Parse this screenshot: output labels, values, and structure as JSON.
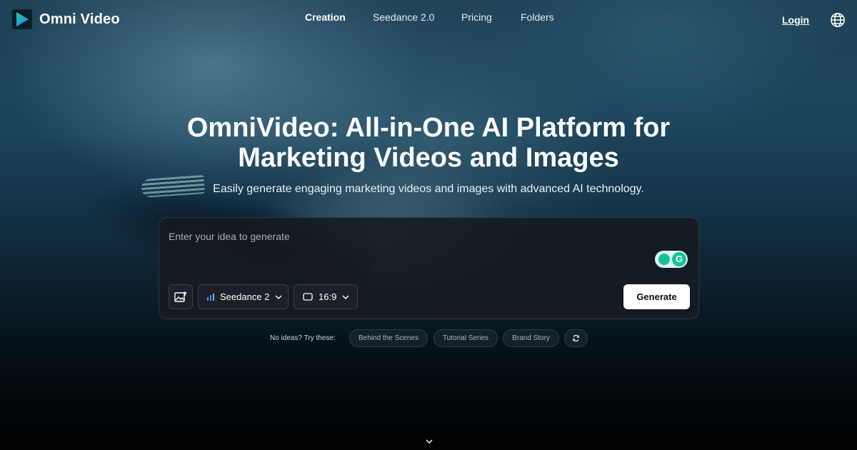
{
  "brand": {
    "name": "Omni Video"
  },
  "nav": {
    "items": [
      {
        "label": "Creation",
        "active": true
      },
      {
        "label": "Seedance 2.0",
        "active": false
      },
      {
        "label": "Pricing",
        "active": false
      },
      {
        "label": "Folders",
        "active": false
      }
    ],
    "login": "Login",
    "language_icon": "globe-icon"
  },
  "hero": {
    "title_line1": "OmniVideo: All-in-One AI Platform for",
    "title_line2": "Marketing Videos and Images",
    "subtitle": "Easily generate engaging marketing videos and images with advanced AI technology."
  },
  "prompt": {
    "placeholder": "Enter your idea to generate",
    "value": "",
    "model": "Seedance 2",
    "aspect_ratio": "16:9",
    "generate_label": "Generate"
  },
  "ideas": {
    "label": "No ideas? Try these:",
    "chips": [
      "Behind the Scenes",
      "Tutorial Series",
      "Brand Story"
    ]
  },
  "colors": {
    "accent_logo": "#22b4e8",
    "grammarly": "#15c39a"
  }
}
